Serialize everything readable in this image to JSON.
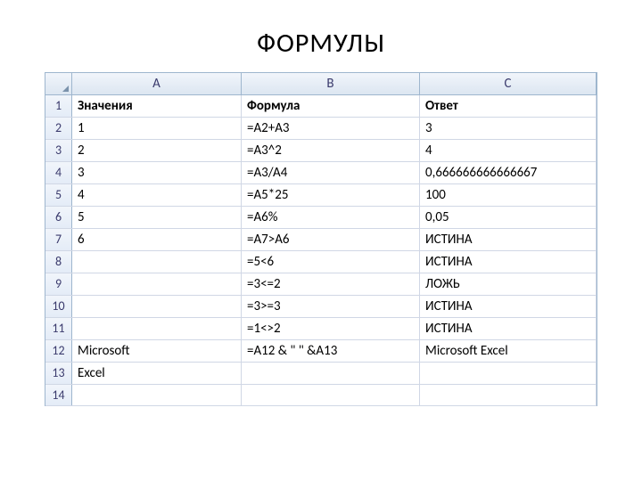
{
  "title": "ФОРМУЛЫ",
  "columns": [
    "A",
    "B",
    "C"
  ],
  "rows": [
    {
      "n": "1",
      "a": "Значения",
      "b": "Формула",
      "c": "Ответ",
      "bold": true
    },
    {
      "n": "2",
      "a": "1",
      "b": "=A2+A3",
      "c": "3"
    },
    {
      "n": "3",
      "a": "2",
      "b": "=A3^2",
      "c": "4"
    },
    {
      "n": "4",
      "a": "3",
      "b": "=A3/A4",
      "c": "0,666666666666667"
    },
    {
      "n": "5",
      "a": "4",
      "b": "=A5*25",
      "c": "100"
    },
    {
      "n": "6",
      "a": "5",
      "b": "=A6%",
      "c": "0,05"
    },
    {
      "n": "7",
      "a": "6",
      "b": "=A7>A6",
      "c": "ИСТИНА"
    },
    {
      "n": "8",
      "a": "",
      "b": "=5<6",
      "c": "ИСТИНА"
    },
    {
      "n": "9",
      "a": "",
      "b": "=3<=2",
      "c": "ЛОЖЬ"
    },
    {
      "n": "10",
      "a": "",
      "b": "=3>=3",
      "c": "ИСТИНА"
    },
    {
      "n": "11",
      "a": "",
      "b": "=1<>2",
      "c": "ИСТИНА"
    },
    {
      "n": "12",
      "a": "Microsoft",
      "b": "=A12 & \" \" &A13",
      "c": "Microsoft Excel"
    },
    {
      "n": "13",
      "a": "Excel",
      "b": "",
      "c": ""
    },
    {
      "n": "14",
      "a": "",
      "b": "",
      "c": ""
    }
  ]
}
